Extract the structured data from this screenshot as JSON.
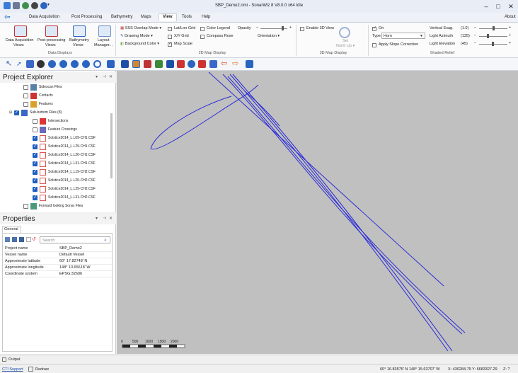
{
  "app": {
    "title": "SBP_Demo2.nmi - SonarWiz 8 V8.0.0 x64  Idle"
  },
  "menu": {
    "items": [
      "Data Acquisition",
      "Post Processing",
      "Bathymetry",
      "Maps",
      "View",
      "Tools",
      "Help"
    ],
    "active": "View",
    "about": "About"
  },
  "ribbon": {
    "data_displays": {
      "label": "Data Displays",
      "buttons": [
        {
          "line1": "Data Acquisition",
          "line2": "Views"
        },
        {
          "line1": "Post-processing",
          "line2": "Views"
        },
        {
          "line1": "Bathymetry",
          "line2": "Views"
        },
        {
          "line1": "Layout",
          "line2": "Manager..."
        }
      ]
    },
    "map2d": {
      "label": "2D Map Display",
      "sss_overlap": "SSS Overlap Mode",
      "drawing_mode": "Drawing Mode",
      "background_color": "Background Color",
      "latlon_grid": "Lat/Lon Grid",
      "xy_grid": "X/Y Grid",
      "map_scale": "Map Scale",
      "color_legend": "Color Legend",
      "compass_rose": "Compass Rose",
      "opacity": "Opacity",
      "orientation": "Orientation"
    },
    "map3d": {
      "label": "3D Map Display",
      "enable_3d": "Enable 3D View",
      "set_north_up_1": "Set",
      "set_north_up_2": "North Up"
    },
    "shaded": {
      "label": "Shaded Relief",
      "on": "On",
      "type_label": "Type",
      "type_value": "Horn",
      "apply_slope": "Apply Slope Correction",
      "vertical_exag": "Vertical Exag.",
      "vertical_exag_val": "(1.0)",
      "light_azimuth": "Light Azimuth",
      "light_azimuth_val": "(135)",
      "light_elevation": "Light Elevation",
      "light_elevation_val": "(45)"
    }
  },
  "explorer": {
    "title": "Project Explorer",
    "items": [
      {
        "label": "Sidescan Files",
        "indent": 1,
        "checked": false,
        "icon": "sidescan"
      },
      {
        "label": "Contacts",
        "indent": 1,
        "checked": false,
        "icon": "contacts"
      },
      {
        "label": "Features",
        "indent": 1,
        "checked": false,
        "icon": "features"
      },
      {
        "label": "Sub-bottom Files (8)",
        "indent": 0,
        "checked": true,
        "icon": "subbottom"
      },
      {
        "label": "Intersections",
        "indent": 2,
        "checked": false,
        "icon": "intersect"
      },
      {
        "label": "Feature Crossings",
        "indent": 2,
        "checked": false,
        "icon": "crossing"
      },
      {
        "label": "Solstice2014_L.L09-CH1.CSF",
        "indent": 2,
        "checked": true,
        "icon": "file"
      },
      {
        "label": "Solstice2014_L.L29-CH1.CSF",
        "indent": 2,
        "checked": true,
        "icon": "file"
      },
      {
        "label": "Solstice2014_L.L20-CH1.CSF",
        "indent": 2,
        "checked": true,
        "icon": "file"
      },
      {
        "label": "Solstice2014_L.L31-CH1.CSF",
        "indent": 2,
        "checked": true,
        "icon": "file"
      },
      {
        "label": "Solstice2014_L.L19-CH2.CSF",
        "indent": 2,
        "checked": true,
        "icon": "file"
      },
      {
        "label": "Solstice2014_L.L20-CH2.CSF",
        "indent": 2,
        "checked": true,
        "icon": "file"
      },
      {
        "label": "Solstice2014_L.L29-CH2.CSF",
        "indent": 2,
        "checked": true,
        "icon": "file"
      },
      {
        "label": "Solstice2014_L.L31-CH2.CSF",
        "indent": 2,
        "checked": true,
        "icon": "file"
      },
      {
        "label": "Forward looking Sonar Files",
        "indent": 1,
        "checked": false,
        "icon": "fls"
      }
    ]
  },
  "properties": {
    "title": "Properties",
    "tab": "General",
    "search_placeholder": "Search",
    "rows": [
      {
        "key": "Project name",
        "value": "SBP_Demo2"
      },
      {
        "key": "Vessel name",
        "value": "Default Vessel"
      },
      {
        "key": "Approximate latitude",
        "value": "60° 17.82748' N"
      },
      {
        "key": "Approximate longitude",
        "value": "148° 10.65618' W"
      },
      {
        "key": "Coordinate system",
        "value": "EPSG:32606"
      }
    ]
  },
  "map": {
    "background": "#c0c0c0",
    "line_color": "#2b2bd6",
    "scale_labels": [
      "0",
      "500",
      "1000",
      "1500",
      "2000"
    ]
  },
  "output": {
    "label": "Output"
  },
  "status": {
    "support": "CTI Support",
    "redraw": "Redraw",
    "coords": "60° 16.83575' N  148° 15.63707' W",
    "xy": "X: 430284.79 Y: 6683327.29",
    "zoom": "Z: ?"
  },
  "colors": {
    "accent": "#1e5fbf",
    "title_bg": "#e9eef6"
  }
}
